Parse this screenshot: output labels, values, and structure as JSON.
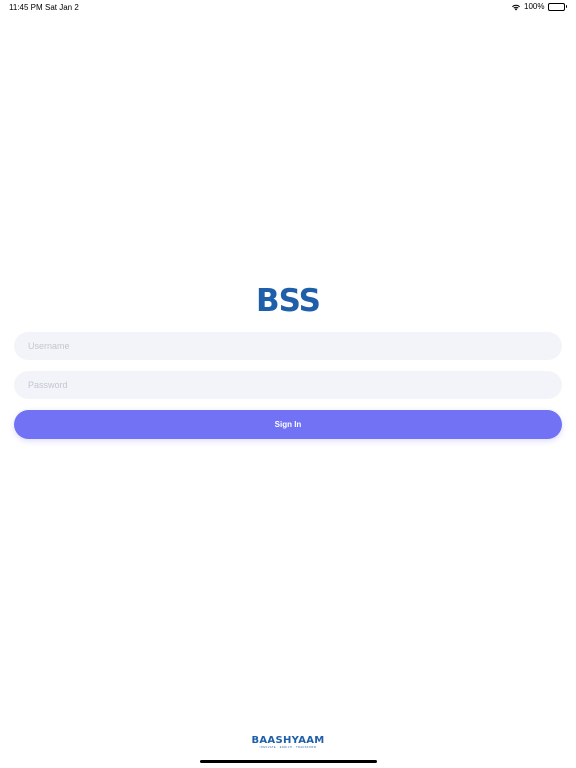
{
  "status_bar": {
    "time": "11:45 PM",
    "date": "Sat Jan 2",
    "battery": "100%"
  },
  "app": {
    "logo_text": "BSS",
    "brand_color": "#1f5ea9"
  },
  "form": {
    "username_placeholder": "Username",
    "password_placeholder": "Password",
    "sign_in_label": "Sign In",
    "button_color": "#7272f4"
  },
  "footer": {
    "brand": "BAASHYAAM",
    "tagline": "INNOVATE · ENRICH · TRANSFORM"
  }
}
